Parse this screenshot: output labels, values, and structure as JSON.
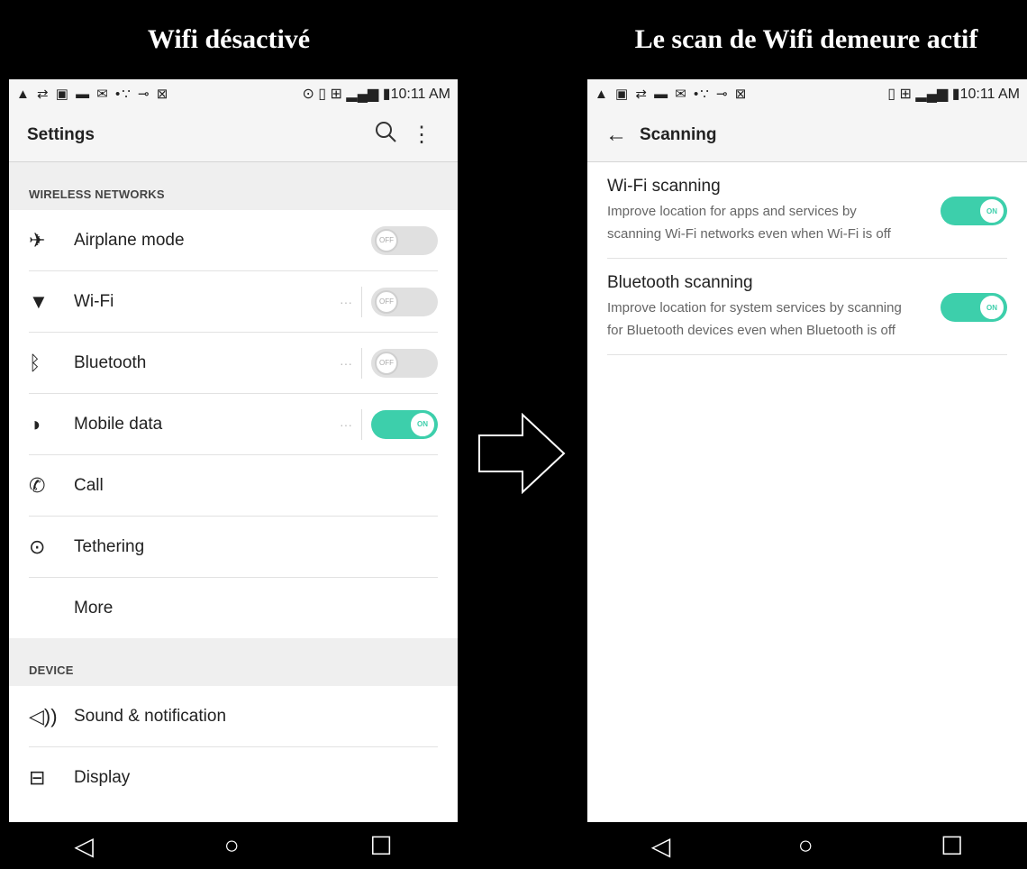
{
  "captions": {
    "left": "Wifi désactivé",
    "right": "Le scan de Wifi demeure actif"
  },
  "left_phone": {
    "status": {
      "icons": "▲ ⇄ ▣ ▬ ✉ •∵ ⊸ ⊠",
      "right": "⊙ ▯ ⊞ ▂▄▆ ▮10:11 AM"
    },
    "appbar": {
      "title": "Settings",
      "search_icon": "search-icon",
      "menu_icon": "more-vert-icon"
    },
    "sections": {
      "wireless": "WIRELESS NETWORKS",
      "device": "DEVICE"
    },
    "items": [
      {
        "label": "Airplane mode",
        "icon": "airplane-icon",
        "glyph": "✈",
        "toggle": "off",
        "toggle_text": "OFF",
        "dots": false
      },
      {
        "label": "Wi-Fi",
        "icon": "wifi-icon",
        "glyph": "▼",
        "toggle": "off",
        "toggle_text": "OFF",
        "dots": true
      },
      {
        "label": "Bluetooth",
        "icon": "bluetooth-icon",
        "glyph": "ᛒ",
        "toggle": "off",
        "toggle_text": "OFF",
        "dots": true
      },
      {
        "label": "Mobile data",
        "icon": "mobile-data-icon",
        "glyph": "◑",
        "toggle": "on",
        "toggle_text": "ON",
        "dots": true
      },
      {
        "label": "Call",
        "icon": "phone-icon",
        "glyph": "✆"
      },
      {
        "label": "Tethering",
        "icon": "tethering-icon",
        "glyph": "⊙"
      },
      {
        "label": "More",
        "icon": "",
        "glyph": ""
      }
    ],
    "device_items": [
      {
        "label": "Sound & notification",
        "icon": "speaker-icon",
        "glyph": "◁))"
      },
      {
        "label": "Display",
        "icon": "display-icon",
        "glyph": "⊟"
      }
    ],
    "dots_text": "···"
  },
  "right_phone": {
    "status": {
      "icons": "▲ ▣ ⇄ ▬ ✉ •∵ ⊸ ⊠",
      "right": "▯ ⊞ ▂▄▆ ▮10:11 AM"
    },
    "appbar": {
      "back": "←",
      "title": "Scanning"
    },
    "scan_items": [
      {
        "title": "Wi-Fi scanning",
        "desc": "Improve location for apps and services by scanning Wi-Fi networks even when Wi-Fi is off",
        "toggle": "on",
        "toggle_text": "ON"
      },
      {
        "title": "Bluetooth scanning",
        "desc": "Improve location for system services by scanning for Bluetooth devices even when Bluetooth is off",
        "toggle": "on",
        "toggle_text": "ON"
      }
    ]
  },
  "navbar": {
    "back": "◁",
    "home": "○",
    "recents": "☐"
  },
  "colors": {
    "accent_on": "#3dcfab",
    "toggle_off": "#e0e0e0"
  }
}
